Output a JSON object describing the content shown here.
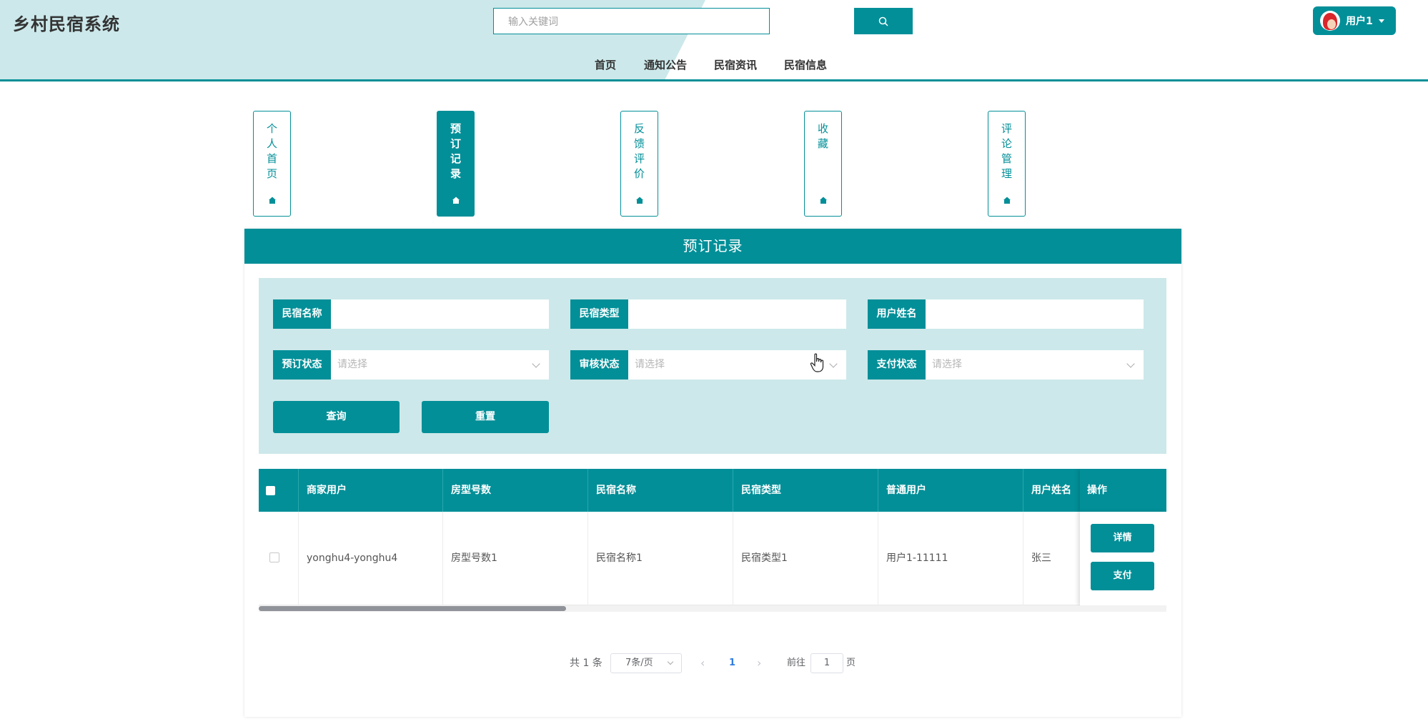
{
  "header": {
    "site_title": "乡村民宿系统",
    "search_placeholder": "输入关键词",
    "user_label": "用户1",
    "nav": [
      "首页",
      "通知公告",
      "民宿资讯",
      "民宿信息"
    ]
  },
  "menu": [
    {
      "label": "个人首页",
      "active": false
    },
    {
      "label": "预订记录",
      "active": true
    },
    {
      "label": "反馈评价",
      "active": false
    },
    {
      "label": "收藏",
      "active": false
    },
    {
      "label": "评论管理",
      "active": false
    }
  ],
  "panel": {
    "title": "预订记录",
    "filters": {
      "homestay_name_label": "民宿名称",
      "homestay_type_label": "民宿类型",
      "user_name_label": "用户姓名",
      "booking_status_label": "预订状态",
      "review_status_label": "审核状态",
      "payment_status_label": "支付状态",
      "select_placeholder": "请选择",
      "query_label": "查询",
      "reset_label": "重置"
    },
    "table": {
      "columns": [
        "商家用户",
        "房型号数",
        "民宿名称",
        "民宿类型",
        "普通用户",
        "用户姓名",
        "操作"
      ],
      "rows": [
        {
          "merchant": "yonghu4-yonghu4",
          "room_type_no": "房型号数1",
          "homestay_name": "民宿名称1",
          "homestay_type": "民宿类型1",
          "user": "用户1-11111",
          "user_name": "张三",
          "actions": [
            "详情",
            "支付"
          ]
        }
      ]
    },
    "pagination": {
      "total": "共 1 条",
      "page_size": "7条/页",
      "current_page": "1",
      "goto_label": "前往",
      "goto_value": "1",
      "page_unit": "页"
    }
  },
  "colors": {
    "accent": "#028f98",
    "filter_bg": "#cce8ea",
    "header_tint": "#cce8ea"
  }
}
